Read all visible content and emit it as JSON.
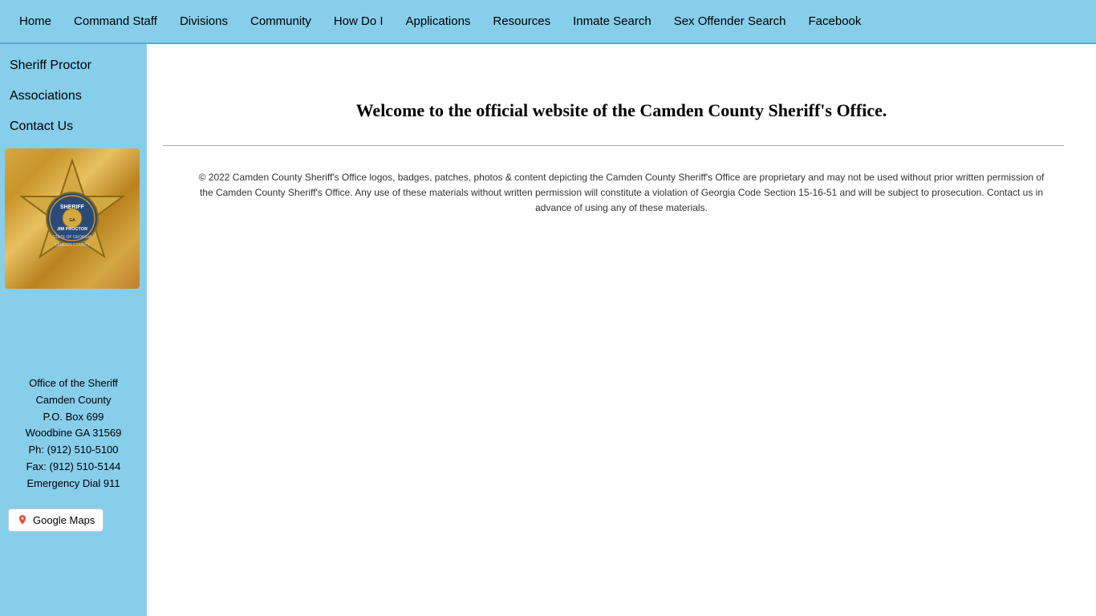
{
  "nav": {
    "items": [
      {
        "label": "Home",
        "id": "home"
      },
      {
        "label": "Command Staff",
        "id": "command-staff"
      },
      {
        "label": "Divisions",
        "id": "divisions"
      },
      {
        "label": "Community",
        "id": "community"
      },
      {
        "label": "How Do I",
        "id": "how-do-i"
      },
      {
        "label": "Applications",
        "id": "applications"
      },
      {
        "label": "Resources",
        "id": "resources"
      },
      {
        "label": "Inmate Search",
        "id": "inmate-search"
      },
      {
        "label": "Sex Offender Search",
        "id": "sex-offender-search"
      },
      {
        "label": "Facebook",
        "id": "facebook"
      }
    ]
  },
  "sidebar": {
    "links": [
      {
        "label": "Sheriff Proctor",
        "id": "sheriff-proctor"
      },
      {
        "label": "Associations",
        "id": "associations"
      },
      {
        "label": "Contact Us",
        "id": "contact-us"
      }
    ]
  },
  "badge": {
    "alt": "Camden County Sheriff Badge - Jim Proctor"
  },
  "address": {
    "line1": "Office of the Sheriff",
    "line2": "Camden County",
    "line3": "P.O. Box 699",
    "line4": "Woodbine GA 31569",
    "phone": "Ph: (912) 510-5100",
    "fax": "Fax: (912) 510-5144",
    "emergency": "Emergency Dial 911"
  },
  "google_maps": {
    "label": "Google Maps"
  },
  "main": {
    "welcome_heading": "Welcome to the official website of the Camden County Sheriff's Office.",
    "copyright": "© 2022 Camden County Sheriff's Office logos, badges, patches, photos & content depicting the Camden County Sheriff's Office are proprietary and may not be used without prior written permission of the Camden County Sheriff's Office. Any use of these materials without written permission will constitute a violation of Georgia Code Section 15-16-51 and will be subject to prosecution. Contact us in advance of using any of these materials."
  }
}
